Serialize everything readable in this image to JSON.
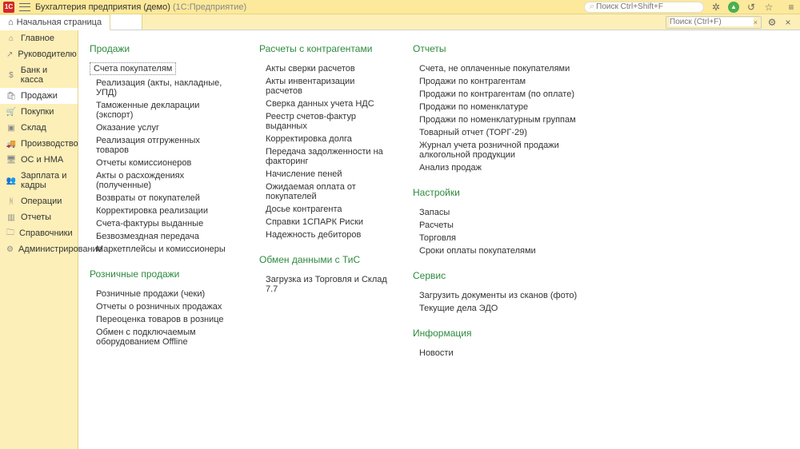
{
  "titlebar": {
    "app": "Бухгалтерия предприятия (демо)",
    "sub": "(1С:Предприятие)",
    "search_placeholder": "Поиск Ctrl+Shift+F"
  },
  "tabs": {
    "start": "Начальная страница",
    "page_search_placeholder": "Поиск (Ctrl+F)"
  },
  "sidebar": {
    "items": [
      {
        "label": "Главное"
      },
      {
        "label": "Руководителю"
      },
      {
        "label": "Банк и касса"
      },
      {
        "label": "Продажи"
      },
      {
        "label": "Покупки"
      },
      {
        "label": "Склад"
      },
      {
        "label": "Производство"
      },
      {
        "label": "ОС и НМА"
      },
      {
        "label": "Зарплата и кадры"
      },
      {
        "label": "Операции"
      },
      {
        "label": "Отчеты"
      },
      {
        "label": "Справочники"
      },
      {
        "label": "Администрирование"
      }
    ]
  },
  "sections": {
    "prodazhi": {
      "head": "Продажи",
      "links": [
        "Счета покупателям",
        "Реализация (акты, накладные, УПД)",
        "Таможенные декларации (экспорт)",
        "Оказание услуг",
        "Реализация отгруженных товаров",
        "Отчеты комиссионеров",
        "Акты о расхождениях (полученные)",
        "Возвраты от покупателей",
        "Корректировка реализации",
        "Счета-фактуры выданные",
        "Безвозмездная передача",
        "Маркетплейсы и комиссионеры"
      ]
    },
    "roznica": {
      "head": "Розничные продажи",
      "links": [
        "Розничные продажи (чеки)",
        "Отчеты о розничных продажах",
        "Переоценка товаров в рознице",
        "Обмен с подключаемым оборудованием Offline"
      ]
    },
    "raschety": {
      "head": "Расчеты с контрагентами",
      "links": [
        "Акты сверки расчетов",
        "Акты инвентаризации расчетов",
        "Сверка данных учета НДС",
        "Реестр счетов-фактур выданных",
        "Корректировка долга",
        "Передача задолженности на факторинг",
        "Начисление пеней",
        "Ожидаемая оплата от покупателей",
        "Досье контрагента",
        "Справки 1СПАРК Риски",
        "Надежность дебиторов"
      ]
    },
    "obmen": {
      "head": "Обмен данными с ТиС",
      "links": [
        "Загрузка из Торговля и Склад 7.7"
      ]
    },
    "otchety": {
      "head": "Отчеты",
      "links": [
        "Счета, не оплаченные покупателями",
        "Продажи по контрагентам",
        "Продажи по контрагентам (по оплате)",
        "Продажи по номенклатуре",
        "Продажи по номенклатурным группам",
        "Товарный отчет (ТОРГ-29)",
        "Журнал учета розничной продажи алкогольной продукции",
        "Анализ продаж"
      ]
    },
    "nastroiki": {
      "head": "Настройки",
      "links": [
        "Запасы",
        "Расчеты",
        "Торговля",
        "Сроки оплаты покупателями"
      ]
    },
    "servis": {
      "head": "Сервис",
      "links": [
        "Загрузить документы из сканов (фото)",
        "Текущие дела ЭДО"
      ]
    },
    "info": {
      "head": "Информация",
      "links": [
        "Новости"
      ]
    }
  }
}
